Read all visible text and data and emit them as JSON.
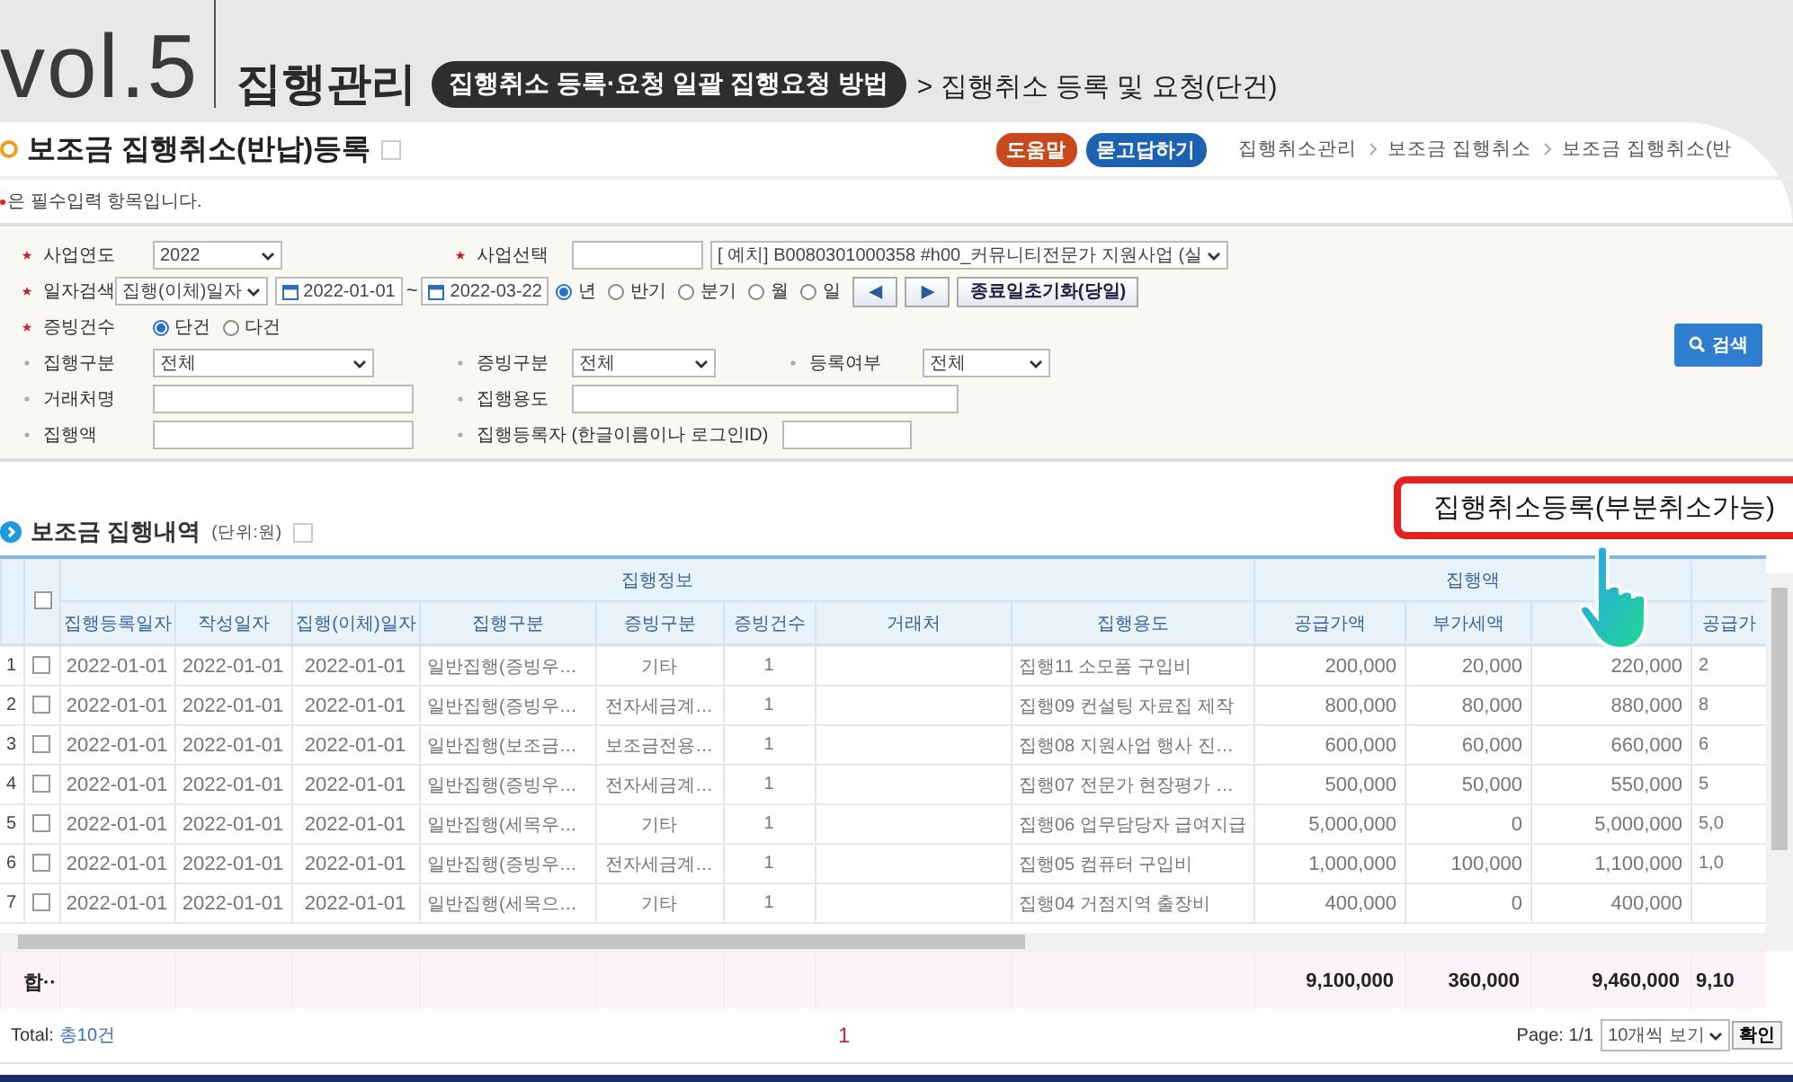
{
  "banner": {
    "volume": "vol.5",
    "chapter": "집행관리",
    "topic": "집행취소 등록·요청 일괄 집행요청 방법",
    "subtitle": "> 집행취소 등록 및 요청(단건)"
  },
  "page": {
    "title": "보조금 집행취소(반납)등록",
    "help_buttons": [
      {
        "label": "도움말",
        "kind": "help"
      },
      {
        "label": "묻고답하기",
        "kind": "qna"
      }
    ],
    "breadcrumb": [
      "집행취소관리",
      "보조금 집행취소",
      "보조금 집행취소(반"
    ],
    "notice": "은 필수입력 항목입니다."
  },
  "form": {
    "rows": [
      {
        "fields": [
          {
            "label": "사업연도",
            "required": true,
            "controls": [
              {
                "kind": "select",
                "value": "2022"
              }
            ]
          },
          {
            "label": "사업선택",
            "required": true,
            "controls": [
              {
                "kind": "input"
              },
              {
                "kind": "select",
                "value": "[   예치] B0080301000358 #h00_커뮤니티전문가 지원사업 (실"
              }
            ]
          }
        ]
      },
      {
        "fields": [
          {
            "label": "일자검색",
            "required": true,
            "controls": [
              {
                "kind": "select",
                "value": "집행(이체)일자"
              },
              {
                "kind": "date",
                "value": "2022-01-01"
              },
              {
                "kind": "text",
                "value": "~"
              },
              {
                "kind": "date",
                "value": "2022-03-22"
              },
              {
                "kind": "radio",
                "label": "년",
                "selected": true
              },
              {
                "kind": "radio",
                "label": "반기",
                "selected": false
              },
              {
                "kind": "radio",
                "label": "분기",
                "selected": false
              },
              {
                "kind": "radio",
                "label": "월",
                "selected": false
              },
              {
                "kind": "radio",
                "label": "일",
                "selected": false
              },
              {
                "kind": "icon-button",
                "label": "◀"
              },
              {
                "kind": "icon-button",
                "label": "▶"
              },
              {
                "kind": "button",
                "label": "종료일초기화(당일)"
              }
            ]
          }
        ]
      },
      {
        "fields": [
          {
            "label": "증빙건수",
            "required": true,
            "controls": [
              {
                "kind": "radio",
                "label": "단건",
                "selected": true
              },
              {
                "kind": "radio",
                "label": "다건",
                "selected": false
              }
            ]
          }
        ]
      },
      {
        "fields": [
          {
            "label": "집행구분",
            "required": false,
            "controls": [
              {
                "kind": "select",
                "value": "전체"
              }
            ]
          },
          {
            "label": "증빙구분",
            "required": false,
            "controls": [
              {
                "kind": "select",
                "value": "전체"
              }
            ]
          },
          {
            "label": "등록여부",
            "required": false,
            "controls": [
              {
                "kind": "select",
                "value": "전체"
              }
            ]
          }
        ]
      },
      {
        "fields": [
          {
            "label": "거래처명",
            "required": false,
            "controls": [
              {
                "kind": "input"
              }
            ]
          },
          {
            "label": "집행용도",
            "required": false,
            "controls": [
              {
                "kind": "input"
              }
            ]
          }
        ]
      },
      {
        "fields": [
          {
            "label": "집행액",
            "required": false,
            "controls": [
              {
                "kind": "input"
              }
            ]
          },
          {
            "label": "집행등록자 (한글이름이나 로그인ID)",
            "required": false,
            "controls": [
              {
                "kind": "input"
              }
            ]
          }
        ]
      }
    ],
    "search_button": "검색"
  },
  "list": {
    "title": "보조금 집행내역",
    "unit": "(단위:원)",
    "action_button": "집행취소등록(부분취소가능)"
  },
  "table": {
    "all_checked": false,
    "column_groups": [
      {
        "label": "집행정보",
        "columns": [
          {
            "label": "집행등록일자",
            "kind": "date"
          },
          {
            "label": "작성일자",
            "kind": "date"
          },
          {
            "label": "집행(이체)일자",
            "kind": "date"
          },
          {
            "label": "집행구분",
            "kind": "text"
          },
          {
            "label": "증빙구분",
            "kind": "center"
          },
          {
            "label": "증빙건수",
            "kind": "center"
          },
          {
            "label": "거래처",
            "kind": "text"
          },
          {
            "label": "집행용도",
            "kind": "text"
          }
        ]
      },
      {
        "label": "집행액",
        "columns": [
          {
            "label": "공급가액",
            "kind": "number"
          },
          {
            "label": "부가세액",
            "kind": "number"
          },
          {
            "kind": "number"
          }
        ]
      },
      {
        "columns": [
          {
            "label": "공급가",
            "kind": "text"
          }
        ]
      }
    ],
    "rows": [
      {
        "number": "1",
        "checked": false,
        "cells": [
          "2022-01-01",
          "2022-01-01",
          "2022-01-01",
          "일반집행(증빙우…",
          "기타",
          "1",
          null,
          "집행11 소모품 구입비",
          "200,000",
          "20,000",
          "220,000",
          "2"
        ]
      },
      {
        "number": "2",
        "checked": false,
        "cells": [
          "2022-01-01",
          "2022-01-01",
          "2022-01-01",
          "일반집행(증빙우…",
          "전자세금계…",
          "1",
          null,
          "집행09 컨설팅 자료집 제작",
          "800,000",
          "80,000",
          "880,000",
          "8"
        ]
      },
      {
        "number": "3",
        "checked": false,
        "cells": [
          "2022-01-01",
          "2022-01-01",
          "2022-01-01",
          "일반집행(보조금…",
          "보조금전용…",
          "1",
          null,
          "집행08 지원사업 행사 진…",
          "600,000",
          "60,000",
          "660,000",
          "6"
        ]
      },
      {
        "number": "4",
        "checked": false,
        "cells": [
          "2022-01-01",
          "2022-01-01",
          "2022-01-01",
          "일반집행(증빙우…",
          "전자세금계…",
          "1",
          null,
          "집행07 전문가 현장평가 …",
          "500,000",
          "50,000",
          "550,000",
          "5"
        ]
      },
      {
        "number": "5",
        "checked": false,
        "cells": [
          "2022-01-01",
          "2022-01-01",
          "2022-01-01",
          "일반집행(세목우…",
          "기타",
          "1",
          null,
          "집행06 업무담당자 급여지급",
          "5,000,000",
          "0",
          "5,000,000",
          "5,0"
        ]
      },
      {
        "number": "6",
        "checked": false,
        "cells": [
          "2022-01-01",
          "2022-01-01",
          "2022-01-01",
          "일반집행(증빙우…",
          "전자세금계…",
          "1",
          null,
          "집행05 컴퓨터 구입비",
          "1,000,000",
          "100,000",
          "1,100,000",
          "1,0"
        ]
      },
      {
        "number": "7",
        "checked": false,
        "cells": [
          "2022-01-01",
          "2022-01-01",
          "2022-01-01",
          "일반집행(세목으…",
          "기타",
          "1",
          null,
          "집행04 거점지역 출장비",
          "400,000",
          "0",
          "400,000",
          null
        ]
      }
    ],
    "total": {
      "label": "합··",
      "cells": [
        null,
        null,
        null,
        null,
        null,
        null,
        null,
        null,
        "9,100,000",
        "360,000",
        "9,460,000",
        "9,10"
      ]
    }
  },
  "footer": {
    "total_label": "Total:",
    "total_count": "총10건",
    "pages": [
      {
        "label": "1",
        "selected": true
      }
    ],
    "page_info": "Page: 1/1",
    "page_size": "10개씩 보기",
    "confirm": "확인"
  }
}
